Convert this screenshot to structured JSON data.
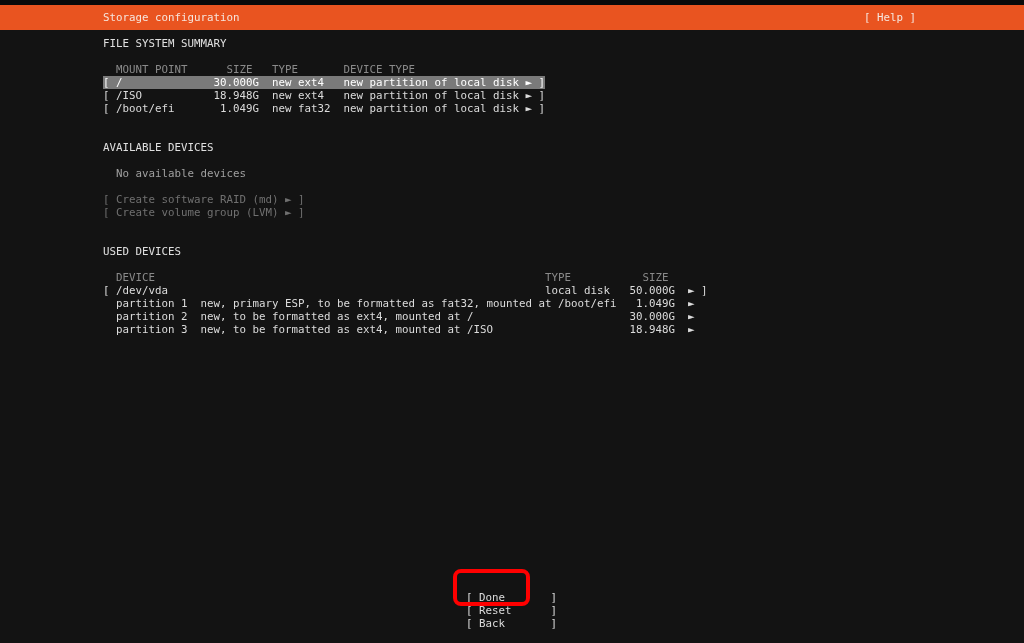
{
  "header": {
    "title": "Storage configuration",
    "help": "[ Help ]"
  },
  "file_system_summary": {
    "title": "FILE SYSTEM SUMMARY",
    "columns": [
      "MOUNT POINT",
      "SIZE",
      "TYPE",
      "DEVICE TYPE"
    ],
    "rows": [
      {
        "open": "[",
        "mount": "/",
        "size": "30.000G",
        "type": "new ext4",
        "device_type": "new partition of local disk",
        "close": "► ]",
        "selected": true
      },
      {
        "open": "[",
        "mount": "/ISO",
        "size": "18.948G",
        "type": "new ext4",
        "device_type": "new partition of local disk",
        "close": "► ]",
        "selected": false
      },
      {
        "open": "[",
        "mount": "/boot/efi",
        "size": "1.049G",
        "type": "new fat32",
        "device_type": "new partition of local disk",
        "close": "► ]",
        "selected": false
      }
    ]
  },
  "available_devices": {
    "title": "AVAILABLE DEVICES",
    "empty": "No available devices",
    "actions": [
      {
        "label": "[ Create software RAID (md) ► ]",
        "disabled": true
      },
      {
        "label": "[ Create volume group (LVM) ► ]",
        "disabled": true
      }
    ]
  },
  "used_devices": {
    "title": "USED DEVICES",
    "columns": [
      "DEVICE",
      "TYPE",
      "SIZE"
    ],
    "rows": [
      {
        "kind": "disk",
        "open": "[",
        "device": "/dev/vda",
        "type": "local disk",
        "size": "50.000G",
        "close": "► ]"
      },
      {
        "kind": "partition",
        "device": "partition 1",
        "description": "new, primary ESP, to be formatted as fat32, mounted at /boot/efi",
        "size": "1.049G",
        "close": "►"
      },
      {
        "kind": "partition",
        "device": "partition 2",
        "description": "new, to be formatted as ext4, mounted at /",
        "size": "30.000G",
        "close": "►"
      },
      {
        "kind": "partition",
        "device": "partition 3",
        "description": "new, to be formatted as ext4, mounted at /ISO",
        "size": "18.948G",
        "close": "►"
      }
    ]
  },
  "buttons": [
    {
      "open": "[",
      "label": "Done",
      "close": "]",
      "highlighted": true
    },
    {
      "open": "[",
      "label": "Reset",
      "close": "]",
      "highlighted": false
    },
    {
      "open": "[",
      "label": "Back",
      "close": "]",
      "highlighted": false
    }
  ]
}
